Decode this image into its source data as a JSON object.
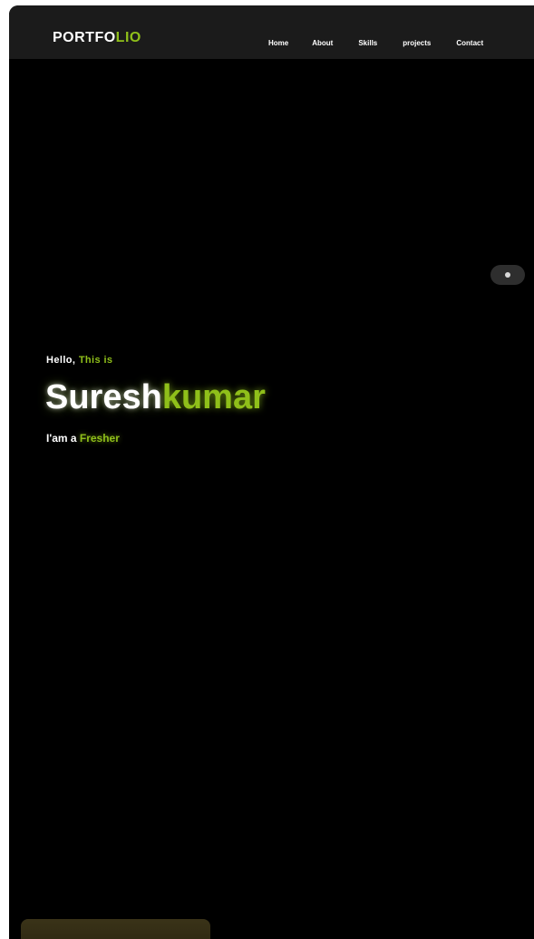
{
  "navbar": {
    "logo_main": "PORTFO",
    "logo_accent": "LIO",
    "links": [
      "Home",
      "About",
      "Skills",
      "projects",
      "Contact"
    ]
  },
  "hero": {
    "greeting_main": "Hello, ",
    "greeting_accent": "This is",
    "name_main": "Suresh",
    "name_accent": "kumar",
    "role_main": "I'am a ",
    "role_accent": "Fresher"
  },
  "about": {
    "heading_main": "",
    "heading_accent": ""
  },
  "colors": {
    "accent": "#8fbf1a",
    "background": "#000000",
    "navbar": "#1b1b1b"
  },
  "icons": {
    "theme_toggle": "theme-toggle-icon"
  }
}
